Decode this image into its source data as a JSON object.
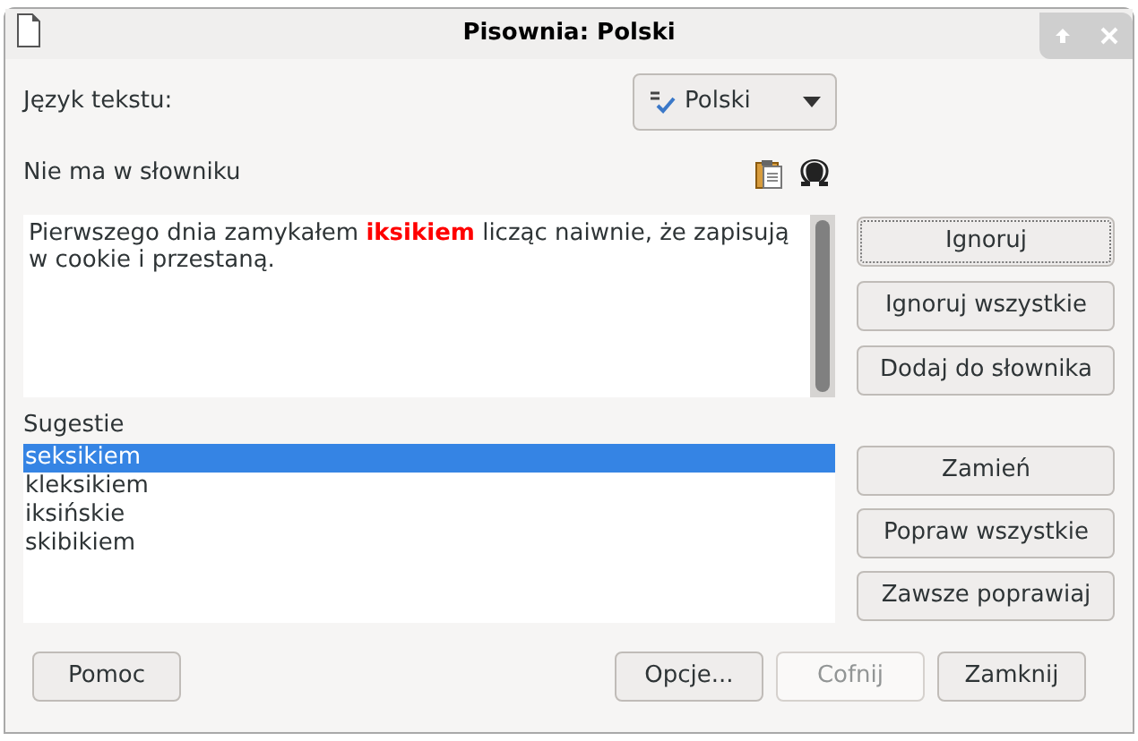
{
  "window": {
    "title": "Pisownia: Polski"
  },
  "language": {
    "label": "Język tekstu:",
    "value": "Polski"
  },
  "not_in_dictionary": {
    "label": "Nie ma w słowniku",
    "sentence_before": "Pierwszego dnia zamykałem ",
    "error_word": "iksikiem",
    "sentence_after": " licząc naiwnie, że zapisują w cookie i przestaną."
  },
  "top_buttons": [
    {
      "label": "Ignoruj",
      "focused": true
    },
    {
      "label": "Ignoruj wszystkie",
      "focused": false
    },
    {
      "label": "Dodaj do słownika",
      "focused": false
    }
  ],
  "suggestions": {
    "label": "Sugestie",
    "items": [
      {
        "text": "seksikiem",
        "selected": true
      },
      {
        "text": "kleksikiem",
        "selected": false
      },
      {
        "text": "iksińskie",
        "selected": false
      },
      {
        "text": "skibikiem",
        "selected": false
      }
    ]
  },
  "suggestion_buttons": [
    {
      "label": "Zamień"
    },
    {
      "label": "Popraw wszystkie"
    },
    {
      "label": "Zawsze poprawiaj"
    }
  ],
  "help_button": {
    "label": "Pomoc"
  },
  "bottom_buttons": [
    {
      "label": "Opcje...",
      "disabled": false
    },
    {
      "label": "Cofnij",
      "disabled": true
    },
    {
      "label": "Zamknij",
      "disabled": false
    }
  ]
}
